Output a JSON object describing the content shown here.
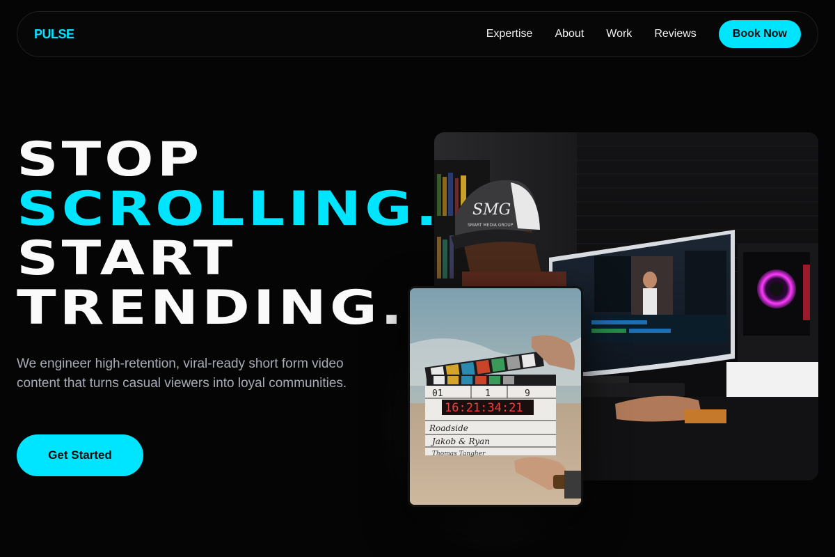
{
  "nav": {
    "logo": "PULSE",
    "links": [
      "Expertise",
      "About",
      "Work",
      "Reviews"
    ],
    "cta": "Book Now"
  },
  "hero": {
    "headline": [
      "STOP",
      "SCROLLING.",
      "START",
      "TRENDING."
    ],
    "subtext": "We engineer high-retention, viral-ready short form video content that turns casual viewers into loyal communities.",
    "cta": "Get Started"
  },
  "images": {
    "editor_photo": {
      "cap_text": "SMG",
      "cap_subtext": "SMART MEDIA GROUP"
    },
    "clapper_photo": {
      "timecode": "16:21:34:21",
      "scene": "01",
      "take": "1",
      "roll": "9",
      "lines": [
        "Roadside",
        "Jakob & Ryan",
        "Thomas Tangher"
      ]
    }
  },
  "colors": {
    "accent": "#00e5ff",
    "background": "#050505",
    "subtext": "#a9acb6"
  }
}
